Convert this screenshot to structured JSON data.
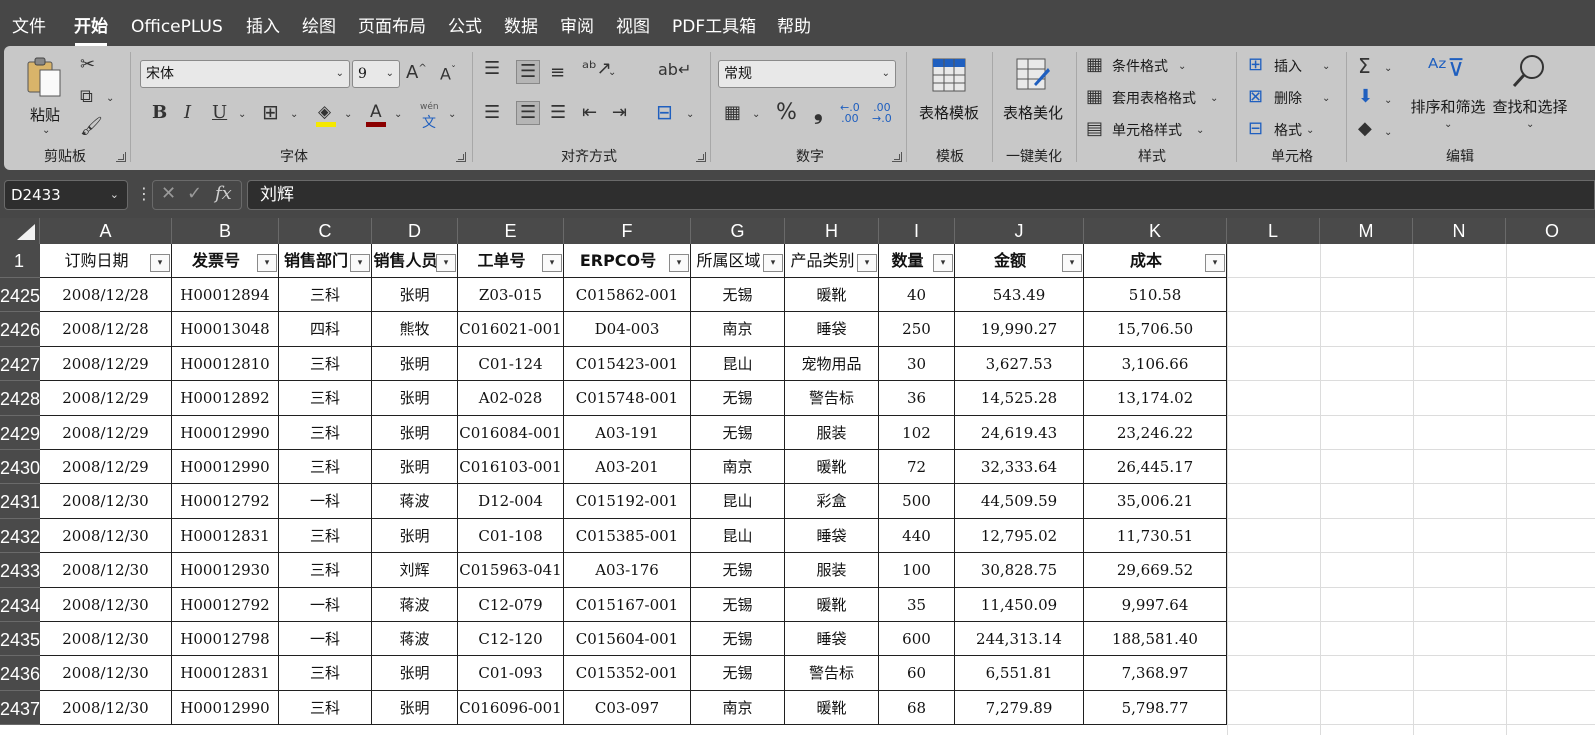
{
  "menu": {
    "tabs": [
      {
        "label": "文件",
        "active": false
      },
      {
        "label": "开始",
        "active": true
      },
      {
        "label": "OfficePLUS",
        "active": false
      },
      {
        "label": "插入",
        "active": false
      },
      {
        "label": "绘图",
        "active": false
      },
      {
        "label": "页面布局",
        "active": false
      },
      {
        "label": "公式",
        "active": false
      },
      {
        "label": "数据",
        "active": false
      },
      {
        "label": "审阅",
        "active": false
      },
      {
        "label": "视图",
        "active": false
      },
      {
        "label": "PDF工具箱",
        "active": false
      },
      {
        "label": "帮助",
        "active": false
      }
    ]
  },
  "ribbon": {
    "clipboard": {
      "paste_label": "粘贴",
      "group_label": "剪贴板"
    },
    "font": {
      "font_name": "宋体",
      "font_size": "9",
      "group_label": "字体",
      "wen_label": "wén",
      "wen_char": "文"
    },
    "alignment": {
      "group_label": "对齐方式"
    },
    "number": {
      "format": "常规",
      "percent": "%",
      "comma": "❟",
      "inc_decimal": "←.0\n.00",
      "group_label": "数字"
    },
    "template": {
      "label": "表格模板",
      "group_label": "模板"
    },
    "beautify": {
      "label": "表格美化",
      "group_label": "一键美化"
    },
    "styles": {
      "conditional": "条件格式",
      "table_format": "套用表格格式",
      "cell_style": "单元格样式",
      "group_label": "样式"
    },
    "cells": {
      "insert": "插入",
      "delete": "删除",
      "format": "格式",
      "group_label": "单元格"
    },
    "editing": {
      "sort_filter": "排序和筛选",
      "find_select": "查找和选择",
      "group_label": "编辑"
    }
  },
  "formula_bar": {
    "cell_ref": "D2433",
    "fx": "fx",
    "value": "刘辉"
  },
  "grid": {
    "columns": [
      "A",
      "B",
      "C",
      "D",
      "E",
      "F",
      "G",
      "H",
      "I",
      "J",
      "K",
      "L",
      "M",
      "N",
      "O"
    ],
    "header_row_number": "1",
    "headers": [
      "订购日期",
      "发票号",
      "销售部门",
      "销售人员",
      "工单号",
      "ERPCO号",
      "所属区域",
      "产品类别",
      "数量",
      "金额",
      "成本"
    ],
    "rows": [
      {
        "n": "2425",
        "cells": [
          "2008/12/28",
          "H00012894",
          "三科",
          "张明",
          "Z03-015",
          "C015862-001",
          "无锡",
          "暖靴",
          "40",
          "543.49",
          "510.58"
        ]
      },
      {
        "n": "2426",
        "cells": [
          "2008/12/28",
          "H00013048",
          "四科",
          "熊牧",
          "C016021-001",
          "D04-003",
          "南京",
          "睡袋",
          "250",
          "19,990.27",
          "15,706.50"
        ]
      },
      {
        "n": "2427",
        "cells": [
          "2008/12/29",
          "H00012810",
          "三科",
          "张明",
          "C01-124",
          "C015423-001",
          "昆山",
          "宠物用品",
          "30",
          "3,627.53",
          "3,106.66"
        ]
      },
      {
        "n": "2428",
        "cells": [
          "2008/12/29",
          "H00012892",
          "三科",
          "张明",
          "A02-028",
          "C015748-001",
          "无锡",
          "警告标",
          "36",
          "14,525.28",
          "13,174.02"
        ]
      },
      {
        "n": "2429",
        "cells": [
          "2008/12/29",
          "H00012990",
          "三科",
          "张明",
          "C016084-001",
          "A03-191",
          "无锡",
          "服装",
          "102",
          "24,619.43",
          "23,246.22"
        ]
      },
      {
        "n": "2430",
        "cells": [
          "2008/12/29",
          "H00012990",
          "三科",
          "张明",
          "C016103-001",
          "A03-201",
          "南京",
          "暖靴",
          "72",
          "32,333.64",
          "26,445.17"
        ]
      },
      {
        "n": "2431",
        "cells": [
          "2008/12/30",
          "H00012792",
          "一科",
          "蒋波",
          "D12-004",
          "C015192-001",
          "昆山",
          "彩盒",
          "500",
          "44,509.59",
          "35,006.21"
        ]
      },
      {
        "n": "2432",
        "cells": [
          "2008/12/30",
          "H00012831",
          "三科",
          "张明",
          "C01-108",
          "C015385-001",
          "昆山",
          "睡袋",
          "440",
          "12,795.02",
          "11,730.51"
        ]
      },
      {
        "n": "2433",
        "cells": [
          "2008/12/30",
          "H00012930",
          "三科",
          "刘辉",
          "C015963-041",
          "A03-176",
          "无锡",
          "服装",
          "100",
          "30,828.75",
          "29,669.52"
        ]
      },
      {
        "n": "2434",
        "cells": [
          "2008/12/30",
          "H00012792",
          "一科",
          "蒋波",
          "C12-079",
          "C015167-001",
          "无锡",
          "暖靴",
          "35",
          "11,450.09",
          "9,997.64"
        ]
      },
      {
        "n": "2435",
        "cells": [
          "2008/12/30",
          "H00012798",
          "一科",
          "蒋波",
          "C12-120",
          "C015604-001",
          "无锡",
          "睡袋",
          "600",
          "244,313.14",
          "188,581.40"
        ]
      },
      {
        "n": "2436",
        "cells": [
          "2008/12/30",
          "H00012831",
          "三科",
          "张明",
          "C01-093",
          "C015352-001",
          "无锡",
          "警告标",
          "60",
          "6,551.81",
          "7,368.97"
        ]
      },
      {
        "n": "2437",
        "cells": [
          "2008/12/30",
          "H00012990",
          "三科",
          "张明",
          "C016096-001",
          "C03-097",
          "南京",
          "暖靴",
          "68",
          "7,279.89",
          "5,798.77"
        ]
      }
    ]
  }
}
